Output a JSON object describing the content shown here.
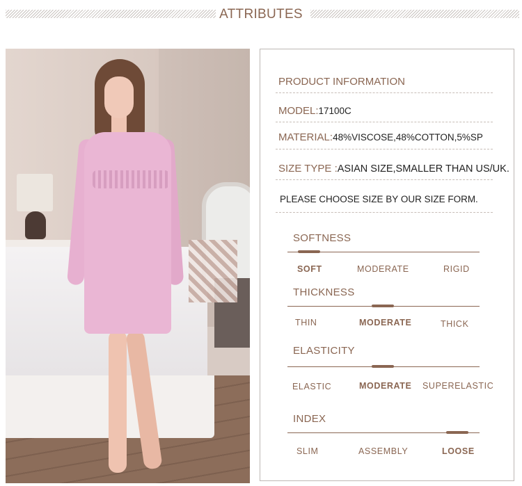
{
  "header": {
    "title": "ATTRIBUTES"
  },
  "product": {
    "heading": "PRODUCT INFORMATION",
    "model_label": "MODEL:",
    "model_value": "17100C",
    "material_label": "MATERIAL:",
    "material_value": "48%VISCOSE,48%COTTON,5%SP",
    "size_label": "SIZE TYPE :",
    "size_value": "ASIAN SIZE,SMALLER THAN US/UK.",
    "note": "PLEASE CHOOSE SIZE BY OUR SIZE FORM."
  },
  "attributes": [
    {
      "title": "SOFTNESS",
      "options": [
        "SOFT",
        "MODERATE",
        "RIGID"
      ],
      "selected": "SOFT"
    },
    {
      "title": "THICKNESS",
      "options": [
        "THIN",
        "MODERATE",
        "THICK"
      ],
      "selected": "MODERATE"
    },
    {
      "title": "ELASTICITY",
      "options": [
        "ELASTIC",
        "MODERATE",
        "SUPERELASTIC"
      ],
      "selected": "MODERATE"
    },
    {
      "title": "INDEX",
      "options": [
        "SLIM",
        "ASSEMBLY",
        "LOOSE"
      ],
      "selected": "LOOSE"
    }
  ],
  "colors": {
    "accent": "#8a6652",
    "dress": "#eab6d4"
  }
}
